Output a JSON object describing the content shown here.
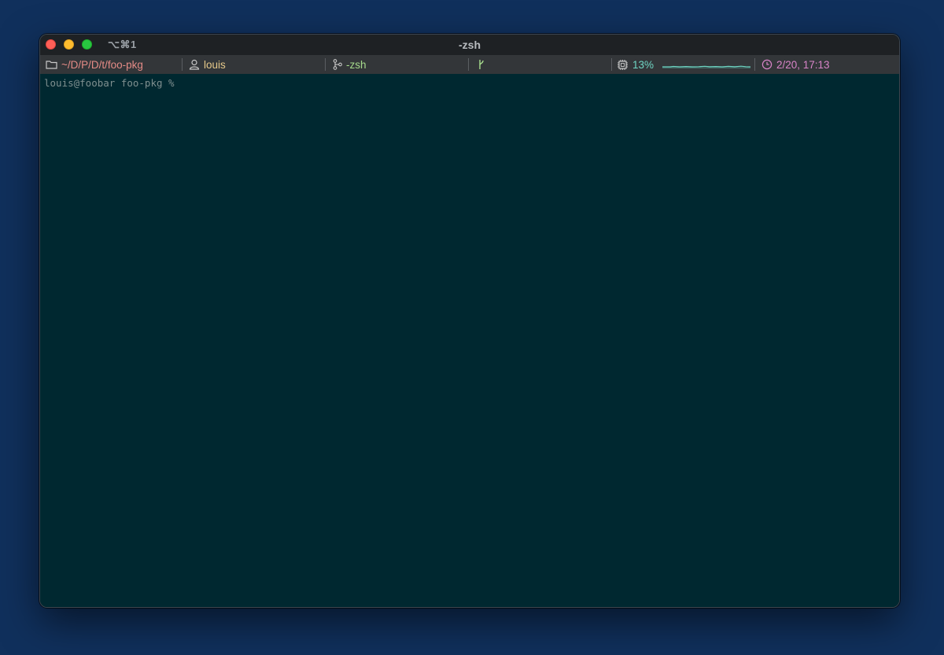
{
  "window": {
    "title": "-zsh",
    "shortcut": "⌥⌘1"
  },
  "statusbar": {
    "path": {
      "icon": "folder-icon",
      "text": "~/D/P/D/t/foo-pkg",
      "color": "#e48b86"
    },
    "user": {
      "icon": "user-icon",
      "text": "louis",
      "color": "#e6c98a"
    },
    "job": {
      "icon": "git-branch-icon",
      "text": "-zsh",
      "color": "#a6db8c"
    },
    "git": {
      "icon": "git-fork-icon",
      "text": ""
    },
    "cpu": {
      "icon": "cpu-icon",
      "text": "13%",
      "color": "#6fd6c4",
      "sparkline": "cpu-sparkline"
    },
    "clock": {
      "icon": "clock-icon",
      "text": "2/20, 17:13",
      "color": "#d884c8"
    }
  },
  "terminal": {
    "prompt": "louis@foobar foo-pkg %"
  },
  "colors": {
    "desktop": "#10305c",
    "terminal_bg": "#002830",
    "titlebar_bg": "#1e2124",
    "statusbar_bg": "#333639"
  }
}
